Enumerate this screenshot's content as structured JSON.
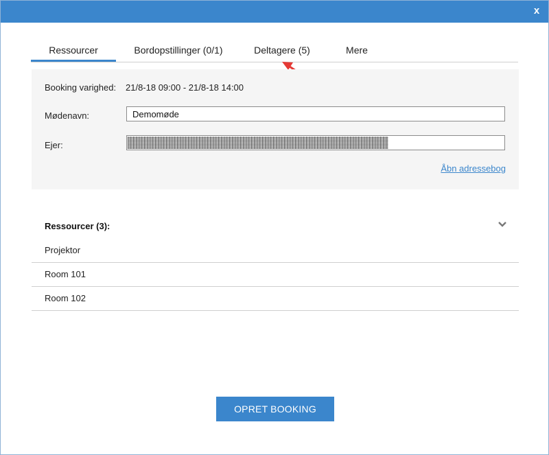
{
  "dialog": {
    "close_label": "x"
  },
  "tabs": [
    {
      "label": "Ressourcer",
      "active": true
    },
    {
      "label": "Bordopstillinger (0/1)",
      "active": false
    },
    {
      "label": "Deltagere (5)",
      "active": false
    },
    {
      "label": "Mere",
      "active": false
    }
  ],
  "form": {
    "duration_label": "Booking varighed:",
    "duration_value": "21/8-18 09:00 - 21/8-18 14:00",
    "meeting_name_label": "Mødenavn:",
    "meeting_name_value": "Demomøde",
    "owner_label": "Ejer:",
    "owner_value": "",
    "address_book_link": "Åbn adressebog"
  },
  "resources": {
    "header": "Ressourcer (3):",
    "items": [
      {
        "label": "Projektor"
      },
      {
        "label": "Room 101"
      },
      {
        "label": "Room 102"
      }
    ]
  },
  "actions": {
    "submit_label": "OPRET BOOKING"
  },
  "colors": {
    "accent": "#3b86cc",
    "annotation_arrow": "#e53935",
    "panel_bg": "#f5f5f5"
  }
}
